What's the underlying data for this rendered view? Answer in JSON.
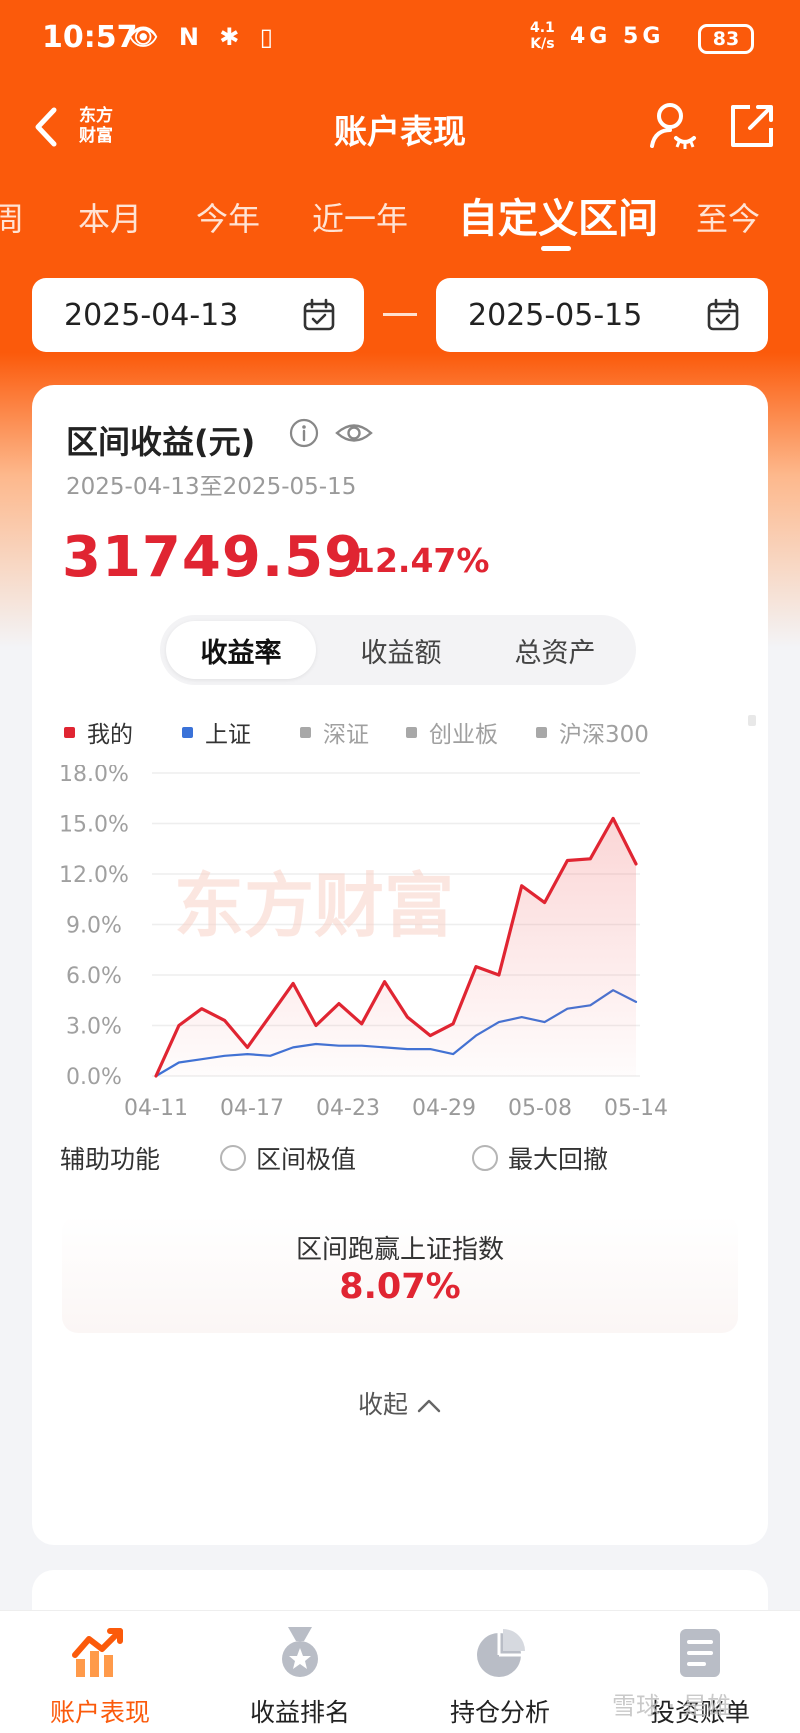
{
  "status_bar": {
    "time": "10:57",
    "left_icons": "👁 Ν ✱ ▯",
    "speed_value": "4.1",
    "speed_unit": "K/s",
    "network": "4G 5G",
    "battery": "83"
  },
  "header": {
    "logo_line1": "东方",
    "logo_line2": "财富",
    "title": "账户表现"
  },
  "tabs": [
    {
      "label": "周"
    },
    {
      "label": "本月"
    },
    {
      "label": "今年"
    },
    {
      "label": "近一年"
    },
    {
      "label": "自定义区间"
    },
    {
      "label": "至今"
    }
  ],
  "active_tab": "自定义区间",
  "date_range": {
    "start": "2025-04-13",
    "end": "2025-05-15",
    "separator": "—"
  },
  "summary": {
    "title": "区间收益(元)",
    "range_text": "2025-04-13至2025-05-15",
    "profit": "31749.59",
    "rate": "12.47%"
  },
  "segments": [
    {
      "label": "收益率",
      "active": true
    },
    {
      "label": "收益额",
      "active": false
    },
    {
      "label": "总资产",
      "active": false
    }
  ],
  "legend": [
    {
      "label": "我的",
      "color": "#e02532"
    },
    {
      "label": "上证",
      "color": "#3a72d8"
    },
    {
      "label": "深证",
      "color": "#a8a8a8"
    },
    {
      "label": "创业板",
      "color": "#a8a8a8"
    },
    {
      "label": "沪深300",
      "color": "#a8a8a8"
    }
  ],
  "chart_data": {
    "type": "line",
    "y_tick_labels": [
      "0.0%",
      "3.0%",
      "6.0%",
      "9.0%",
      "12.0%",
      "15.0%",
      "18.0%"
    ],
    "ylim": [
      0,
      18
    ],
    "x_tick_labels": [
      "04-11",
      "04-17",
      "04-23",
      "04-29",
      "05-08",
      "05-14"
    ],
    "watermark": "东方财富",
    "grid": true,
    "series": [
      {
        "name": "我的",
        "color": "#e02532",
        "values": [
          0.0,
          3.0,
          4.0,
          3.3,
          1.7,
          3.6,
          5.5,
          3.0,
          4.3,
          3.1,
          5.6,
          3.5,
          2.4,
          3.1,
          6.5,
          6.0,
          11.3,
          10.3,
          12.8,
          12.9,
          15.3,
          12.6
        ]
      },
      {
        "name": "上证",
        "color": "#3a72d8",
        "values": [
          0.0,
          0.8,
          1.0,
          1.2,
          1.3,
          1.2,
          1.7,
          1.9,
          1.8,
          1.8,
          1.7,
          1.6,
          1.6,
          1.3,
          2.4,
          3.2,
          3.5,
          3.2,
          4.0,
          4.2,
          5.1,
          4.4
        ]
      }
    ]
  },
  "aux": {
    "label": "辅助功能",
    "option1": "区间极值",
    "option2": "最大回撤"
  },
  "beat": {
    "label": "区间跑赢上证指数",
    "value": "8.07%"
  },
  "collapse_label": "收起",
  "bottom_nav": [
    {
      "label": "账户表现",
      "active": true
    },
    {
      "label": "收益排名",
      "active": false
    },
    {
      "label": "持仓分析",
      "active": false
    },
    {
      "label": "投资账单",
      "active": false
    }
  ],
  "watermark": "雪球 · 是雄"
}
